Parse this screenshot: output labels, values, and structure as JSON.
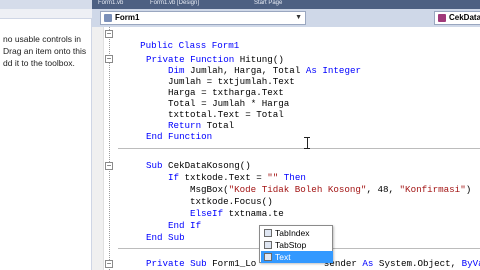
{
  "tabs": [
    "Form1.vb",
    "Form1.vb [Design]",
    "Start Page"
  ],
  "nav": {
    "left_combo": "Form1",
    "right_combo": "CekDataKosong"
  },
  "toolbox": {
    "message_lines": [
      "no usable controls in",
      "Drag an item onto this",
      "dd it to the toolbox."
    ]
  },
  "code": {
    "l01": {
      "a": "Public Class Form1"
    },
    "l02": {
      "a": "Private Function",
      "b": " Hitung()"
    },
    "l03": {
      "a": "Dim",
      "b": " Jumlah, Harga, Total ",
      "c": "As Integer"
    },
    "l04": {
      "a": "Jumlah = txtjumlah.Text"
    },
    "l05": {
      "a": "Harga = txtharga.Text"
    },
    "l06": {
      "a": "Total = Jumlah * Harga"
    },
    "l07": {
      "a": "txttotal.Text = Total"
    },
    "l08": {
      "a": "Return",
      "b": " Total"
    },
    "l09": {
      "a": "End Function"
    },
    "l10": {
      "a": "Sub",
      "b": " CekDataKosong()"
    },
    "l11": {
      "a": "If",
      "b": " txtkode.Text = ",
      "c": "\"\"",
      "d": " Then"
    },
    "l12": {
      "a": "MsgBox(",
      "b": "\"Kode Tidak Boleh Kosong\"",
      "c": ", 48, ",
      "d": "\"Konfirmasi\"",
      "e": ")"
    },
    "l13": {
      "a": "txtkode.Focus()"
    },
    "l14": {
      "a": "ElseIf",
      "b": " txtnama.te"
    },
    "l15": {
      "a": "End If"
    },
    "l16": {
      "a": "End Sub"
    },
    "l17": {
      "a": "Private Sub",
      "b": " Form1_Lo",
      "c": " sender ",
      "d": "As",
      "e": " System.Object, ",
      "f": "ByVal"
    }
  },
  "intellisense": {
    "items": [
      "TabIndex",
      "TabStop",
      "Text"
    ],
    "selected_index": 2
  },
  "colors": {
    "keyword": "#0000ff",
    "string": "#a31515",
    "selection": "#3399ff"
  }
}
